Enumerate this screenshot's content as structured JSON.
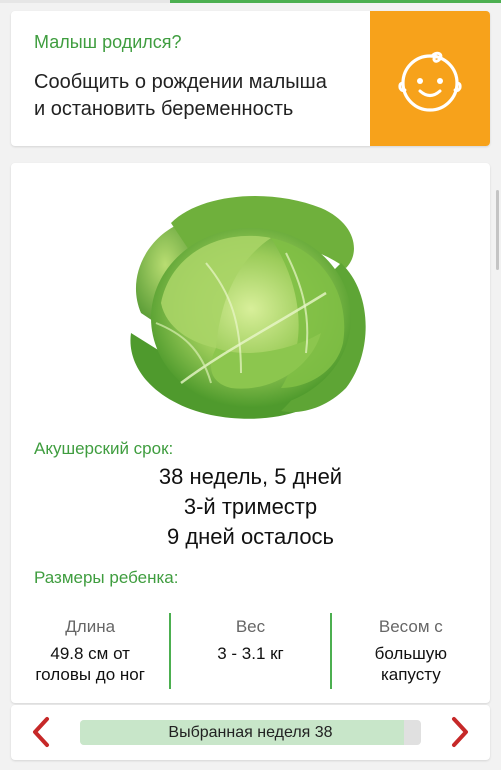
{
  "top_progress": {
    "fraction": 0.66,
    "color": "#4caf50"
  },
  "banner": {
    "title": "Малыш родился?",
    "text_line1": "Сообщить о рождении малыша",
    "text_line2": "и остановить беременность",
    "icon": "baby-face-icon",
    "accent_color": "#f7a21b"
  },
  "main": {
    "image_icon": "cabbage-image",
    "term_label": "Акушерский срок:",
    "term_lines": [
      "38 недель, 5 дней",
      "3-й триместр",
      "9 дней осталось"
    ],
    "sizes_label": "Размеры ребенка:",
    "stats": [
      {
        "label": "Длина",
        "value_line1": "49.8 см от",
        "value_line2": "головы до ног"
      },
      {
        "label": "Вес",
        "value_line1": "3 - 3.1 кг",
        "value_line2": ""
      },
      {
        "label": "Весом с",
        "value_line1": "большую",
        "value_line2": "капусту"
      }
    ]
  },
  "week_nav": {
    "label": "Выбранная неделя 38",
    "progress_fraction": 0.95,
    "prev_icon": "chevron-left-icon",
    "next_icon": "chevron-right-icon",
    "arrow_color": "#c62828"
  }
}
